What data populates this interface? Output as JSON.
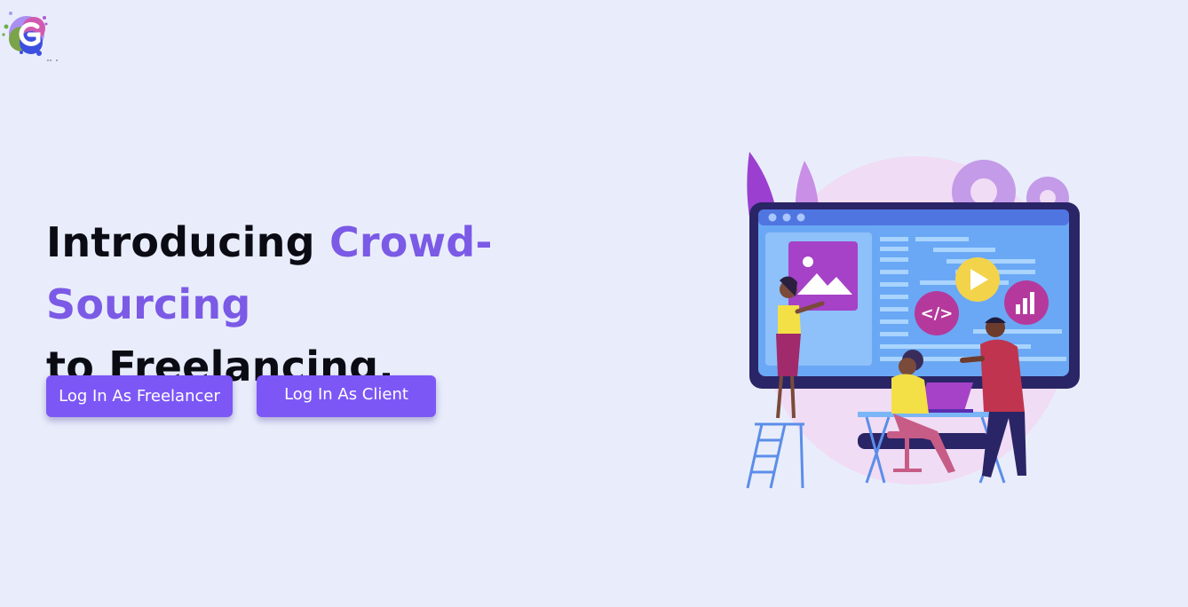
{
  "brand": {
    "logo_icon": "brand-g-logo-icon"
  },
  "hero": {
    "headline_part1": "Introducing ",
    "headline_accent": "Crowd-Sourcing",
    "headline_part2": "to Freelancing.",
    "accent_color": "#7b5ae6"
  },
  "actions": {
    "freelancer_login_label": "Log In As Freelancer",
    "client_login_label": "Log In As Client",
    "button_color": "#7c57f5"
  },
  "illustration": {
    "icon": "team-collaboration-illustration"
  }
}
